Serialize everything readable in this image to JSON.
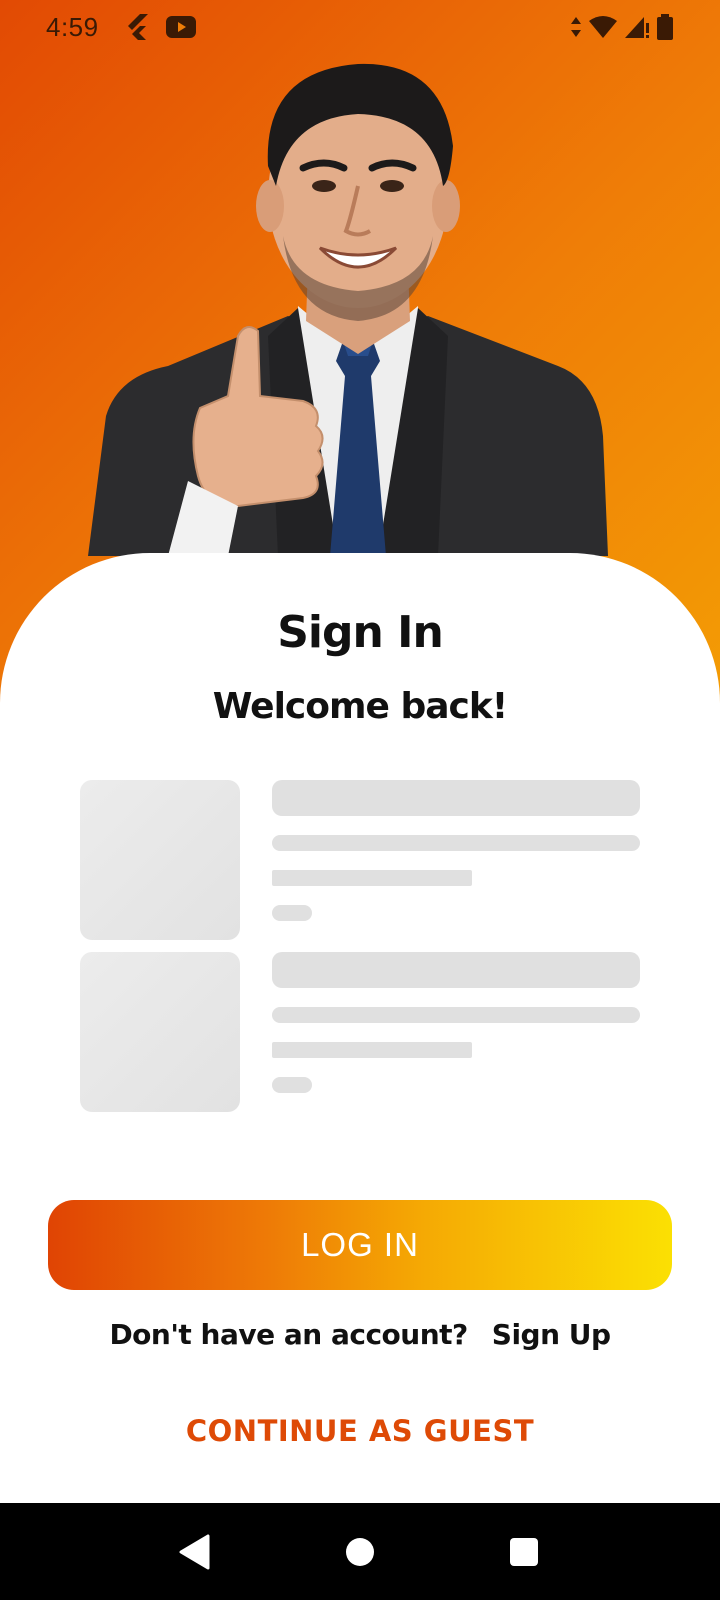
{
  "status_bar": {
    "time": "4:59",
    "left_icons": [
      "flutter-icon",
      "youtube-icon"
    ],
    "right_icons": [
      "data-arrows-icon",
      "wifi-icon",
      "signal-icon",
      "battery-icon"
    ]
  },
  "hero": {
    "image": "businessman-thumbs-up"
  },
  "colors": {
    "gradient_start": "#e24a04",
    "gradient_end": "#f8cf03",
    "accent": "#de4a06",
    "skeleton": "#e0e0e0"
  },
  "signin": {
    "title": "Sign In",
    "subtitle": "Welcome back!"
  },
  "skeleton_items": [
    {
      "type": "loading-placeholder"
    },
    {
      "type": "loading-placeholder"
    }
  ],
  "login_button": {
    "label": "LOG IN"
  },
  "signup": {
    "prompt": "Don't have an account?",
    "link": "Sign Up"
  },
  "guest_button": {
    "label": "CONTINUE AS GUEST"
  },
  "nav_bar": {
    "buttons": [
      "back-icon",
      "home-icon",
      "recents-icon"
    ]
  }
}
